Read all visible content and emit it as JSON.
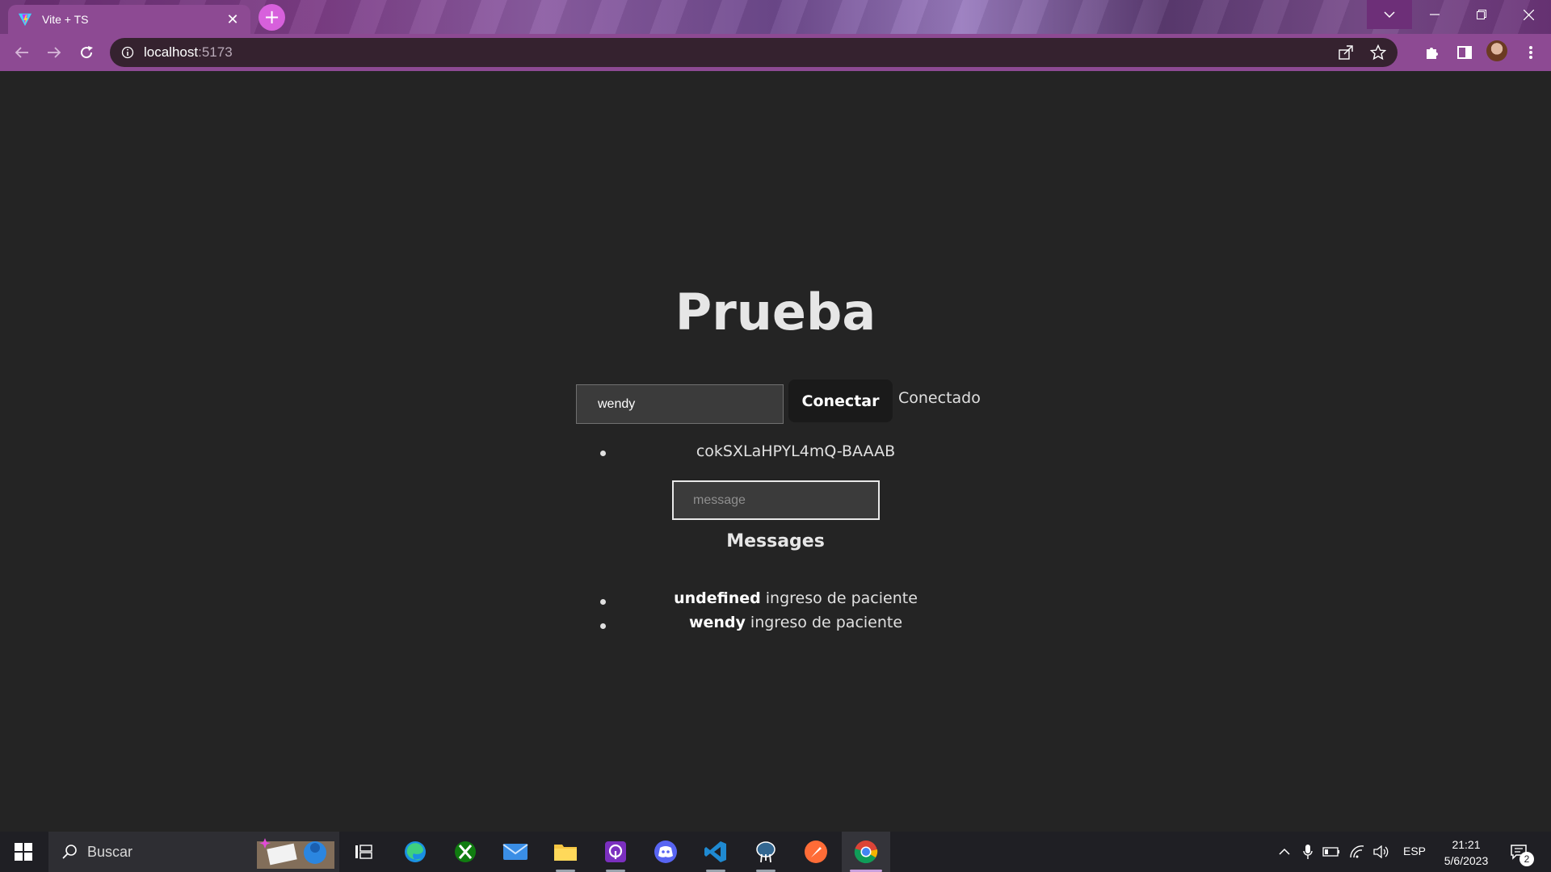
{
  "browser": {
    "tab": {
      "title": "Vite + TS",
      "close_glyph": "✕"
    },
    "new_tab_glyph": "+",
    "address": {
      "host": "localhost",
      "port": ":5173"
    }
  },
  "app": {
    "heading": "Prueba",
    "name_input": {
      "value": "wendy"
    },
    "connect_button": "Conectar",
    "status": "Conectado",
    "socket_ids": [
      "cokSXLaHPYL4mQ-BAAAB"
    ],
    "message_input": {
      "placeholder": "message",
      "value": ""
    },
    "messages_title": "Messages",
    "messages": [
      {
        "user": "undefined",
        "text": " ingreso de paciente"
      },
      {
        "user": "wendy",
        "text": " ingreso de paciente"
      }
    ]
  },
  "taskbar": {
    "search_label": "Buscar",
    "apps": [
      "task-view",
      "edge",
      "xbox",
      "mail",
      "file-explorer",
      "app-purple",
      "discord",
      "vscode",
      "pgadmin",
      "postman",
      "chrome"
    ],
    "language": "ESP",
    "time": "21:21",
    "date": "5/6/2023",
    "notification_count": "2"
  },
  "colors": {
    "accent": "#8d4a93",
    "page_bg": "#242424",
    "button_bg": "#1a1a1a"
  }
}
